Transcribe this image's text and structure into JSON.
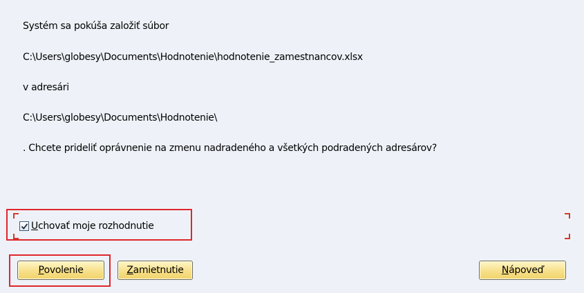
{
  "message": {
    "line1": "Systém sa pokúša založiť súbor",
    "line2": "C:\\Users\\globesy\\Documents\\Hodnotenie\\hodnotenie_zamestnancov.xlsx",
    "line3": "v adresári",
    "line4": "C:\\Users\\globesy\\Documents\\Hodnotenie\\",
    "line5": ". Chcete prideliť oprávnenie na zmenu nadradeného a všetkých podradených adresárov?"
  },
  "remember": {
    "checked": true,
    "label_accel": "U",
    "label_rest": "chovať moje rozhodnutie"
  },
  "buttons": {
    "allow": {
      "accel": "P",
      "rest": "ovolenie"
    },
    "deny": {
      "accel": "Z",
      "rest": "amietnutie"
    },
    "help": {
      "accel": "N",
      "rest": "ápoveď"
    }
  },
  "colors": {
    "background": "#eef2f8",
    "highlight": "#e0252a",
    "button_fill": "#f7e08a"
  }
}
